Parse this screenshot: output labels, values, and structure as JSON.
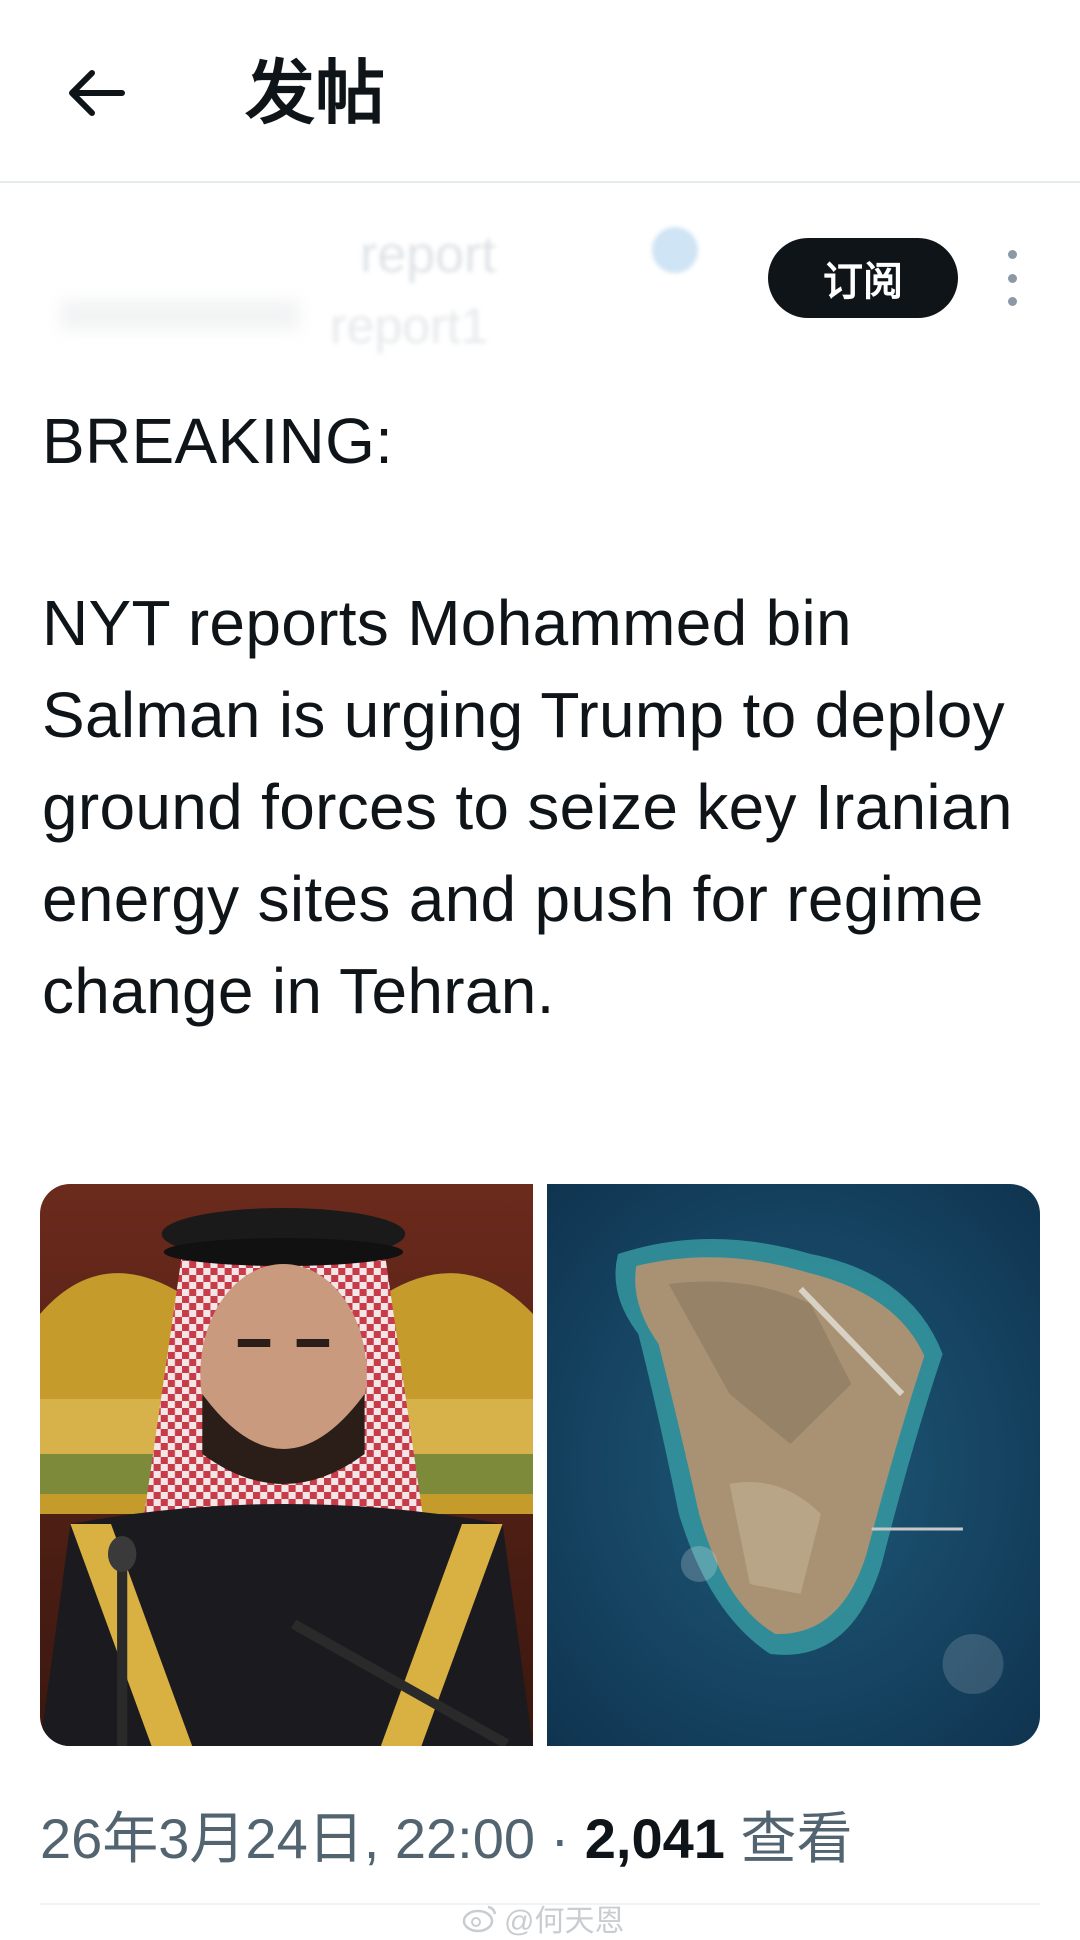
{
  "header": {
    "title": "发帖"
  },
  "author": {
    "name": "report",
    "handle": "report1"
  },
  "actions": {
    "subscribe_label": "订阅"
  },
  "tweet": {
    "lines": [
      "BREAKING:",
      "NYT reports Mohammed bin Salman is urging Trump to deploy ground forces to seize key Iranian energy sites and push for regime change in Tehran."
    ]
  },
  "meta": {
    "datetime": "26年3月24日, 22:00",
    "separator": " · ",
    "views_count": "2,041",
    "views_label": "查看"
  },
  "watermark": {
    "text": "@何天恩"
  },
  "icons": {
    "back": "arrow-left-icon",
    "more": "more-vertical-icon",
    "verified": "verified-badge-icon",
    "weibo": "weibo-icon"
  },
  "colors": {
    "text": "#0f1419",
    "secondary": "#536471",
    "divider": "#eff3f4",
    "button": "#0f1419"
  }
}
